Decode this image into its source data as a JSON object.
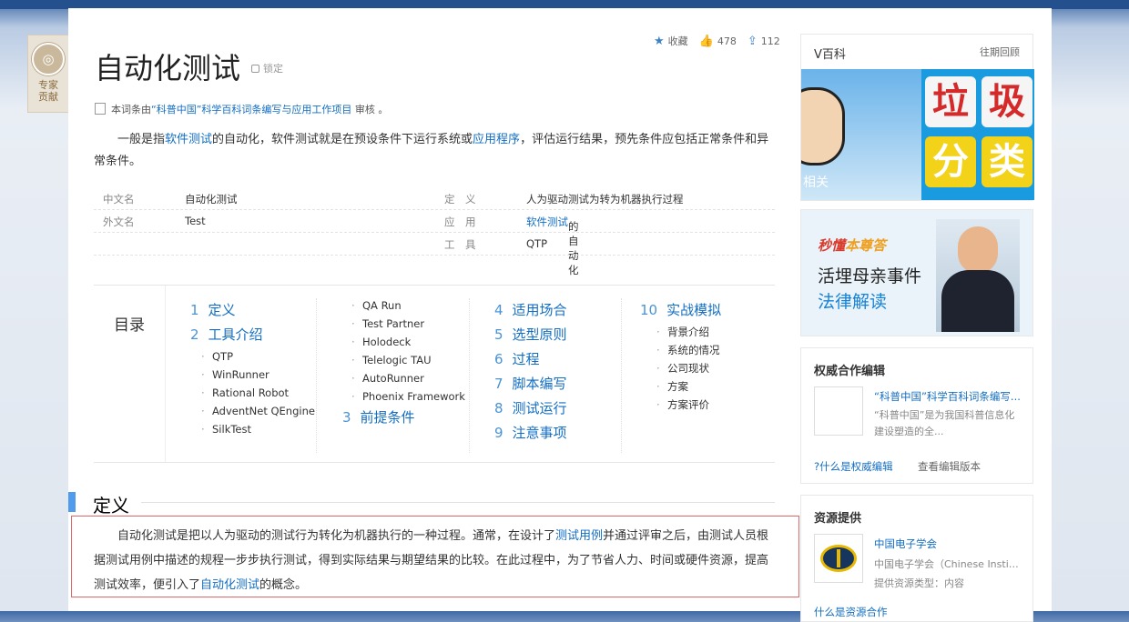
{
  "badge": {
    "icon": "expert-icon",
    "line1": "专家",
    "line2": "贡献"
  },
  "title": "自动化测试",
  "lock_label": "锁定",
  "actions": {
    "favorite": "收藏",
    "likes": "478",
    "shares": "112"
  },
  "review": {
    "prefix": "本词条由",
    "link": "“科普中国”科学百科词条编写与应用工作项目",
    "suffix": " 审核 。"
  },
  "intro": {
    "p1": "一般是指",
    "link1": "软件测试",
    "p2": "的自动化，软件测试就是在预设条件下运行系统或",
    "link2": "应用程序",
    "p3": "，评估运行结果，预先条件应包括正常条件和异常条件。"
  },
  "basic_info": {
    "left": [
      {
        "key": "中文名",
        "value": "自动化测试"
      },
      {
        "key": "外文名",
        "value": "Test"
      }
    ],
    "right": [
      {
        "key": "定　义",
        "value": "人为驱动测试为转为机器执行过程"
      },
      {
        "key": "应　用",
        "link": "软件测试",
        "value": "的自动化"
      },
      {
        "key": "工　具",
        "value": "QTP"
      }
    ]
  },
  "toc": {
    "label": "目录",
    "col1": {
      "items": [
        {
          "n": "1",
          "label": "定义"
        },
        {
          "n": "2",
          "label": "工具介绍"
        }
      ],
      "sub": [
        "QTP",
        "WinRunner",
        "Rational Robot",
        "AdventNet QEngine",
        "SilkTest"
      ]
    },
    "col2": {
      "sub": [
        "QA Run",
        "Test Partner",
        "Holodeck",
        "Telelogic TAU",
        "AutoRunner",
        "Phoenix Framework"
      ],
      "items": [
        {
          "n": "3",
          "label": "前提条件"
        }
      ]
    },
    "col3": {
      "items": [
        {
          "n": "4",
          "label": "适用场合"
        },
        {
          "n": "5",
          "label": "选型原则"
        },
        {
          "n": "6",
          "label": "过程"
        },
        {
          "n": "7",
          "label": "脚本编写"
        },
        {
          "n": "8",
          "label": "测试运行"
        },
        {
          "n": "9",
          "label": "注意事项"
        }
      ]
    },
    "col4": {
      "items": [
        {
          "n": "10",
          "label": "实战模拟"
        }
      ],
      "sub": [
        "背景介绍",
        "系统的情况",
        "公司现状",
        "方案",
        "方案评价"
      ]
    }
  },
  "section": {
    "title": "定义",
    "p1": "自动化测试是把以人为驱动的测试行为转化为机器执行的一种过程。通常，在设计了",
    "link1": "测试用例",
    "p2": "并通过评审之后，由测试人员根据测试用例中描述的规程一步步执行测试，得到实际结果与期望结果的比较。在此过程中，为了节省人力、时间或硬件资源，提高测试效率，便引入了",
    "link2": "自动化测试",
    "p3": "的概念。"
  },
  "vbaike": {
    "title": "V百科",
    "more": "往期回顾",
    "caption": "相关",
    "blocks": [
      "垃",
      "圾",
      "分",
      "类"
    ]
  },
  "ad": {
    "brand_a": "秒懂",
    "brand_b": "本尊答",
    "line1": "活埋母亲事件",
    "line2": "法律解读"
  },
  "authority": {
    "title": "权威合作编辑",
    "name": "“科普中国”科学百科词条编写...",
    "desc": "“科普中国”是为我国科普信息化建设塑造的全...",
    "link1": "什么是权威编辑",
    "link2": "查看编辑版本"
  },
  "resource": {
    "title": "资源提供",
    "name": "中国电子学会",
    "desc": "中国电子学会（Chinese Instit...",
    "type": "提供资源类型：内容",
    "footer": "什么是资源合作"
  }
}
